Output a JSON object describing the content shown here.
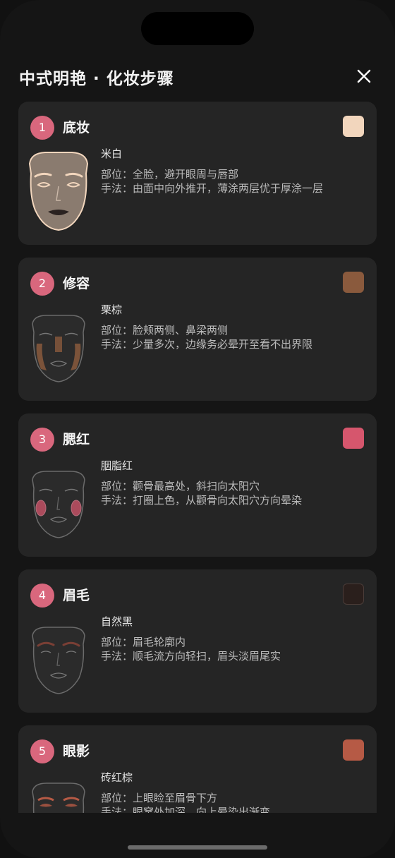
{
  "header": {
    "title": "中式明艳 · 化妆步骤"
  },
  "steps": [
    {
      "num": "1",
      "title": "底妆",
      "shade": "米白",
      "area": "部位：全脸，避开眼周与唇部",
      "method": "手法：由面中向外推开，薄涂两层优于厚涂一层",
      "swatch": "#f2d6bd"
    },
    {
      "num": "2",
      "title": "修容",
      "shade": "栗棕",
      "area": "部位：脸颊两侧、鼻梁两侧",
      "method": "手法：少量多次，边缘务必晕开至看不出界限",
      "swatch": "#8a5a3d"
    },
    {
      "num": "3",
      "title": "腮红",
      "shade": "胭脂红",
      "area": "部位：颧骨最高处，斜扫向太阳穴",
      "method": "手法：打圈上色，从颧骨向太阳穴方向晕染",
      "swatch": "#d6566d"
    },
    {
      "num": "4",
      "title": "眉毛",
      "shade": "自然黑",
      "area": "部位：眉毛轮廓内",
      "method": "手法：顺毛流方向轻扫，眉头淡眉尾实",
      "swatch": "#2a1f1c"
    },
    {
      "num": "5",
      "title": "眼影",
      "shade": "砖红棕",
      "area": "部位：上眼睑至眉骨下方",
      "method": "手法：眼窝处加深，向上晕染出渐变",
      "swatch": "#b65a45"
    }
  ],
  "icons": {
    "close": "close-icon",
    "face": "face-diagram-icon"
  }
}
